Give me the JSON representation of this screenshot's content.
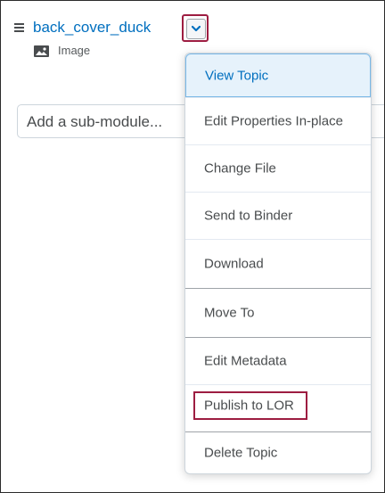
{
  "module": {
    "title": "back_cover_duck",
    "type_label": "Image"
  },
  "add_submodule": {
    "placeholder": "Add a sub-module..."
  },
  "context_menu": {
    "items": [
      {
        "label": "View Topic",
        "state": "hover"
      },
      {
        "label": "Edit Properties In-place"
      },
      {
        "label": "Change File"
      },
      {
        "label": "Send to Binder"
      },
      {
        "label": "Download"
      },
      {
        "label": "Move To"
      },
      {
        "label": "Edit Metadata"
      },
      {
        "label": "Publish to LOR",
        "state": "highlighted"
      },
      {
        "label": "Delete Topic"
      }
    ]
  },
  "colors": {
    "link": "#006fbf",
    "highlight_outline": "#9d1d41",
    "hover_bg": "#e6f2fb"
  },
  "icons": [
    "drag-handle-icon",
    "chevron-down-icon",
    "image-icon"
  ]
}
